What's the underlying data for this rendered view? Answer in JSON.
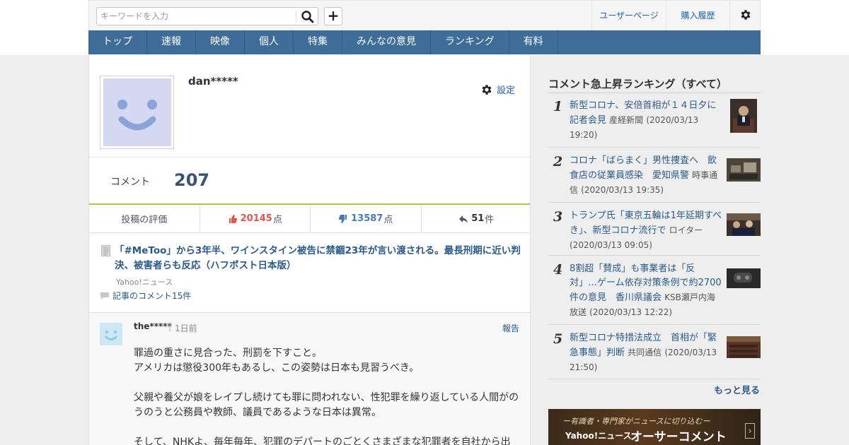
{
  "header": {
    "search_placeholder": "キーワードを入力",
    "search_icon": "search-icon",
    "add_label": "+",
    "user_page": "ユーザーページ",
    "purchase_history": "購入履歴",
    "gear_icon": "gear-icon"
  },
  "nav": {
    "items": [
      "トップ",
      "速報",
      "映像",
      "個人",
      "特集",
      "みんなの意見",
      "ランキング",
      "有料"
    ]
  },
  "profile": {
    "username": "dan*****",
    "settings_label": "設定",
    "comment_label": "コメント",
    "comment_count": "207",
    "rating_label": "投稿の評価",
    "likes": "20145",
    "dislikes": "13587",
    "replies": "51",
    "points_unit": "点",
    "count_unit": "件"
  },
  "article": {
    "title": "「#MeToo」から3年半、ワインスタイン被告に禁錮23年が言い渡される。最長刑期に近い判決、被害者らも反応（ハフポスト日本版）",
    "source": "Yahoo!ニュース",
    "comments_link": "記事のコメント15件"
  },
  "comment": {
    "user": "the*****",
    "separator": "|",
    "time": "1日前",
    "report": "報告",
    "lines": [
      "罪過の重さに見合った、刑罰を下すこと。",
      "アメリカは懲役300年もあるし、この姿勢は日本も見習うべき。",
      "",
      "父親や養父が娘をレイプし続けても罪に問われない、性犯罪を繰り返している人間がのうのうと公務員や教師、議員であるような日本は異常。",
      "",
      "そして、NHKよ、毎年毎年、犯罪のデパートのごとくさまざまな犯罪者を自社から出"
    ]
  },
  "sidebar": {
    "title": "コメント急上昇ランキング（すべて）",
    "items": [
      {
        "rank": "1",
        "title": "新型コロナ、安倍首相が１４日夕に記者会見",
        "source": "産経新聞",
        "date": "(2020/03/13 19:20)"
      },
      {
        "rank": "2",
        "title": "コロナ「ばらまく」男性捜査へ　飲食店の従業員感染　愛知県警",
        "source": "時事通信",
        "date": "(2020/03/13 19:35)"
      },
      {
        "rank": "3",
        "title": "トランプ氏「東京五輪は1年延期すべき」、新型コロナ流行で",
        "source": "ロイター",
        "date": "(2020/03/13 09:05)"
      },
      {
        "rank": "4",
        "title": "8割超「賛成」も事業者は「反対」…ゲーム依存対策条例で約2700件の意見　香川県議会",
        "source": "KSB瀬戸内海放送",
        "date": "(2020/03/13 12:22)"
      },
      {
        "rank": "5",
        "title": "新型コロナ特措法成立　首相が「緊急事態」判断",
        "source": "共同通信",
        "date": "(2020/03/13 21:50)"
      }
    ],
    "more": "もっと見る"
  },
  "banner": {
    "subtitle": "ー有識者・専門家がニュースに切り込むー",
    "brand": "Yahoo!ニュース",
    "main": "オーサーコメント",
    "arrow": "›"
  }
}
